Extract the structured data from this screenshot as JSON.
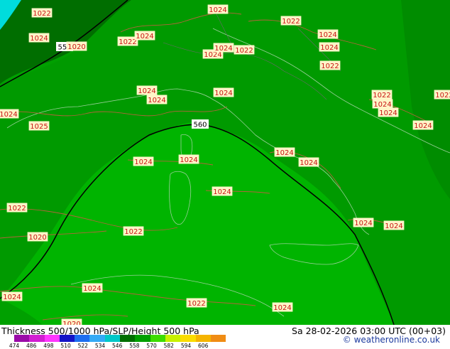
{
  "title": "Thickness 500/1000 hPa/SLP/Height 500 hPa",
  "valid_time": "Sa 28-02-2026 03:00 UTC (00+03)",
  "credit": "© weatheronline.co.uk",
  "thickness_contours": [
    "552",
    "560"
  ],
  "slp_labels": [
    "1022",
    "1024",
    "1020",
    "1022",
    "1024",
    "1024",
    "1022",
    "1024",
    "1024",
    "1022",
    "1024",
    "1024",
    "1024",
    "1024",
    "1022",
    "1024",
    "1024",
    "1024",
    "1024",
    "1024",
    "1025",
    "1024",
    "1024",
    "1024",
    "1024",
    "1024",
    "1024",
    "1024",
    "1024",
    "1022",
    "1020",
    "1022",
    "1024",
    "1024",
    "1022",
    "1020",
    "1022",
    "1022",
    "1024",
    "102"
  ],
  "legend": {
    "colors": [
      "#9a0aa8",
      "#d21ed2",
      "#ff36ff",
      "#1414c8",
      "#1e6ef0",
      "#34aaf5",
      "#00c8c8",
      "#006e00",
      "#00a000",
      "#3cdc00",
      "#c8f000",
      "#fadc00",
      "#f5b400",
      "#f08c14"
    ],
    "ticks": [
      "474",
      "486",
      "498",
      "510",
      "522",
      "534",
      "546",
      "558",
      "570",
      "582",
      "594",
      "606"
    ]
  }
}
